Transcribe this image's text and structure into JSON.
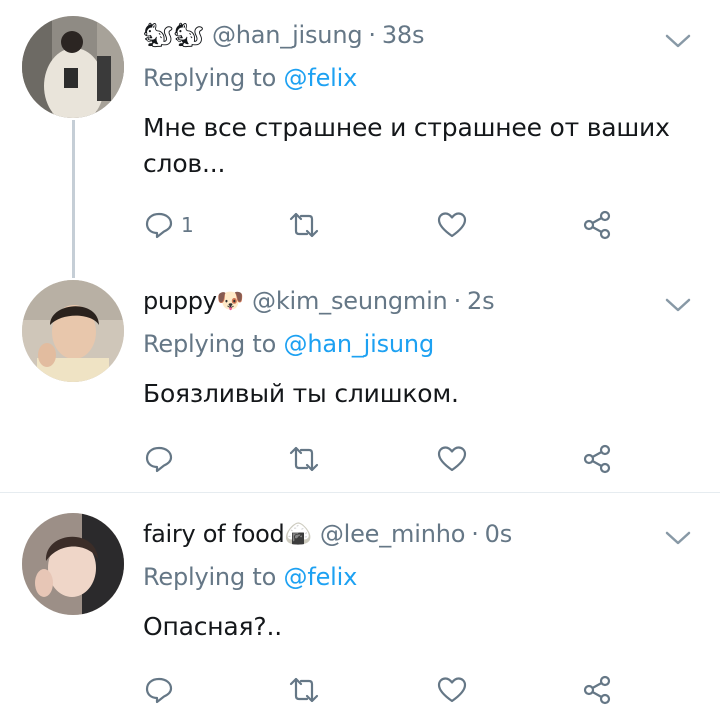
{
  "tweets": [
    {
      "emoji_prefix": "🐿🐿",
      "display_name": "",
      "handle": "@han_jisung",
      "dot": "·",
      "time": "38s",
      "replying_prefix": "Replying to",
      "replying_to": "@felix",
      "text": "Мне все страшнее и страшнее от ваших слов...",
      "reply_count": "1"
    },
    {
      "display_name": "puppy",
      "emoji_suffix": "🐶",
      "handle": "@kim_seungmin",
      "dot": "·",
      "time": "2s",
      "replying_prefix": "Replying to",
      "replying_to": "@han_jisung",
      "text": "Боязливый ты слишком.",
      "reply_count": ""
    },
    {
      "display_name": "fairy of food",
      "emoji_suffix": "🍙",
      "handle": "@lee_minho",
      "dot": "·",
      "time": "0s",
      "replying_prefix": "Replying to",
      "replying_to": "@felix",
      "text": "Опасная?..",
      "reply_count": ""
    }
  ],
  "icons": {
    "reply": "reply-icon",
    "retweet": "retweet-icon",
    "like": "heart-icon",
    "share": "share-icon",
    "more": "chevron-down-icon"
  },
  "colors": {
    "text": "#14171a",
    "secondary": "#657786",
    "accent": "#1da1f2",
    "divider": "#e6ecf0",
    "thread_line": "#c5ced6"
  }
}
